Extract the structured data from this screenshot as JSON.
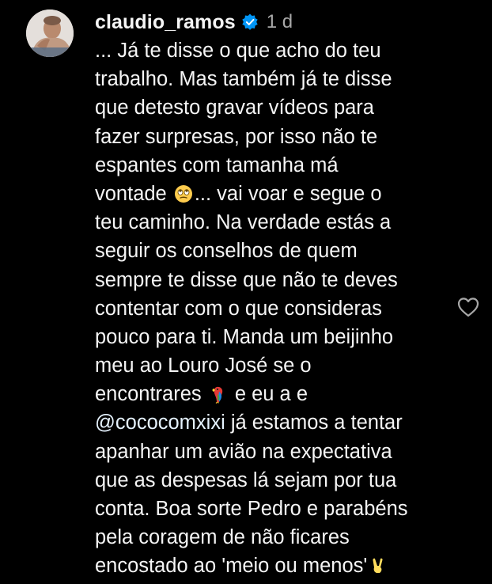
{
  "comment": {
    "username": "claudio_ramos",
    "timestamp": "1 d",
    "verified_icon": "verified-badge-icon",
    "like_icon": "heart-outline-icon",
    "colors": {
      "background": "#000000",
      "text": "#f5f5f5",
      "secondary": "#a8a8a8",
      "verified": "#0095f6",
      "mention": "#e0f1ff"
    },
    "lines": [
      "... Já te disse o que acho do teu",
      "trabalho. Mas também já te disse",
      "que detesto gravar vídeos para",
      "fazer surpresas, por isso não te",
      "espantes com tamanha má",
      {
        "before": "vontade ",
        "emoji": "face-with-rolling-eyes-emoji",
        "after": "... vai voar e segue o"
      },
      "teu caminho. Na verdade estás a",
      "seguir os conselhos de quem",
      "sempre te disse que não te deves",
      "contentar com o que consideras",
      "pouco para ti. Manda um beijinho",
      "meu ao Louro José se o",
      {
        "before": "encontrares ",
        "emoji": "parrot-emoji",
        "after": "  e eu a e"
      },
      {
        "mention": "@cococomxixi",
        "after": " já estamos a tentar"
      },
      "apanhar um avião na expectativa",
      "que as despesas lá sejam por tua",
      "conta. Boa sorte Pedro e parabéns",
      "pela coragem de não ficares",
      {
        "before": "encostado ao 'meio ou menos'",
        "emoji": "victory-hand-emoji",
        "after": ""
      }
    ]
  }
}
